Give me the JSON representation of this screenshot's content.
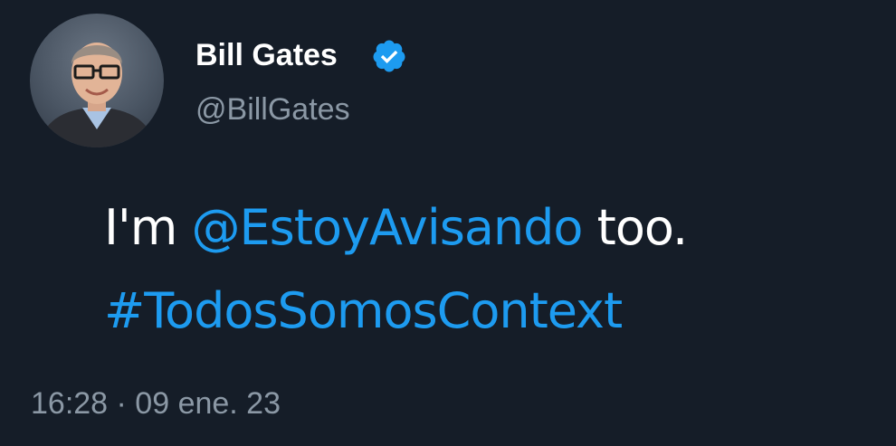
{
  "tweet": {
    "author": {
      "display_name": "Bill Gates",
      "handle": "@BillGates",
      "verified_icon": "verified-badge-icon"
    },
    "body": {
      "prefix": "I'm",
      "mention": "@EstoyAvisando",
      "suffix": "too.",
      "hashtag": "#TodosSomosContext"
    },
    "timestamp": "16:28 · 09 ene. 23"
  },
  "colors": {
    "background": "#151d28",
    "text_primary": "#ffffff",
    "text_secondary": "#8b98a5",
    "accent": "#1d9bf0"
  }
}
